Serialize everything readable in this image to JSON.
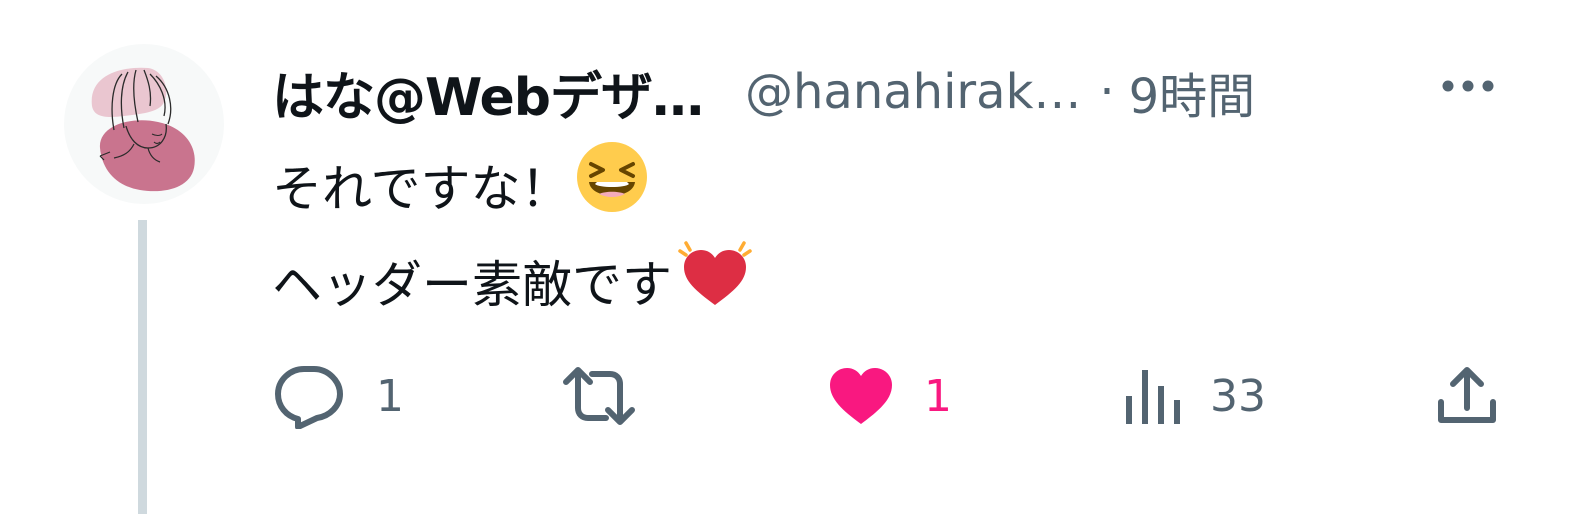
{
  "tweet": {
    "display_name": "はな@Webデザ…",
    "handle": "@hanahirak…",
    "separator": "·",
    "time": "9時間",
    "text_line1": "それですな！",
    "text_line2": "ヘッダー素敵です",
    "emoji_line1": "laughing-face",
    "emoji_line2": "beating-heart"
  },
  "actions": {
    "reply_count": "1",
    "retweet_count": "",
    "like_count": "1",
    "views_count": "33"
  },
  "icons": {
    "more": "more-dots-icon",
    "reply": "reply-bubble-icon",
    "retweet": "retweet-arrows-icon",
    "like": "heart-icon",
    "views": "analytics-bars-icon",
    "share": "share-upload-icon"
  },
  "colors": {
    "text_primary": "#0f1419",
    "text_secondary": "#536471",
    "like_active": "#f91880",
    "thread_line": "#cfd9de",
    "avatar_pink": "#c9748e"
  }
}
